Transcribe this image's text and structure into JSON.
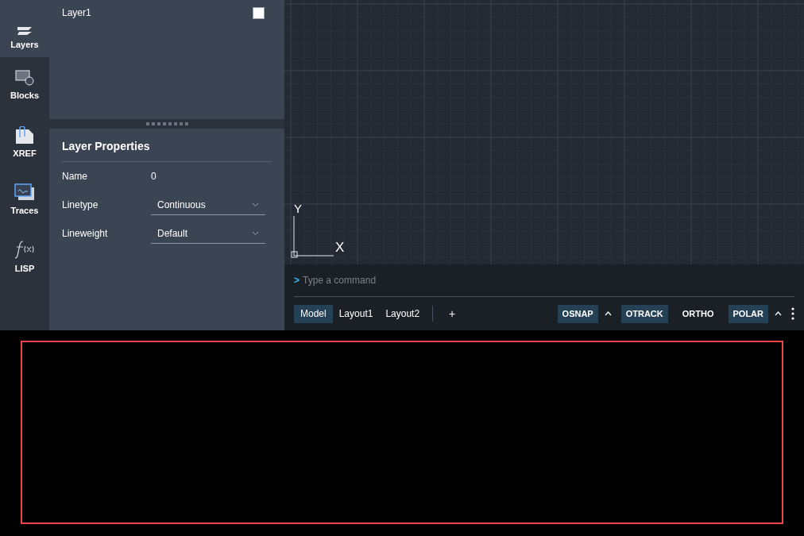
{
  "rail": [
    {
      "kind": "layers",
      "label": "Layers",
      "selected": true
    },
    {
      "kind": "blocks",
      "label": "Blocks",
      "selected": false
    },
    {
      "kind": "xref",
      "label": "XREF",
      "selected": false
    },
    {
      "kind": "traces",
      "label": "Traces",
      "selected": false
    },
    {
      "kind": "lisp",
      "label": "LISP",
      "selected": false
    }
  ],
  "layers": [
    {
      "name": "Layer1",
      "color": "#ffffff"
    }
  ],
  "properties": {
    "title": "Layer Properties",
    "rows": [
      {
        "kind": "text",
        "label": "Name",
        "value": "0"
      },
      {
        "kind": "dropdown",
        "label": "Linetype",
        "value": "Continuous"
      },
      {
        "kind": "dropdown",
        "label": "Lineweight",
        "value": "Default"
      }
    ]
  },
  "canvas": {
    "axis_y": "Y",
    "axis_x": "X"
  },
  "command": {
    "prompt": ">",
    "placeholder": "Type a command"
  },
  "layout_tabs": [
    {
      "label": "Model",
      "selected": true
    },
    {
      "label": "Layout1",
      "selected": false
    },
    {
      "label": "Layout2",
      "selected": false
    }
  ],
  "add_tab": "+",
  "toggles": [
    {
      "label": "OSNAP",
      "on": true,
      "menu": true
    },
    {
      "label": "OTRACK",
      "on": true,
      "menu": false
    },
    {
      "label": "ORTHO",
      "on": false,
      "menu": false
    },
    {
      "label": "POLAR",
      "on": true,
      "menu": true
    }
  ]
}
